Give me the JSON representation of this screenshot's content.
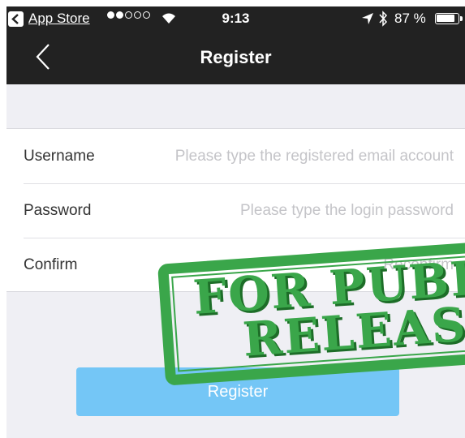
{
  "status_bar": {
    "back_app_label": "App Store",
    "signal_dots_filled": 2,
    "signal_dots_total": 5,
    "time": "9:13",
    "battery_percent_label": "87 %",
    "battery_level": 0.87
  },
  "nav": {
    "title": "Register",
    "back_icon": "chevron-left-icon"
  },
  "form": {
    "username": {
      "label": "Username",
      "placeholder": "Please type the registered email account",
      "value": ""
    },
    "password": {
      "label": "Password",
      "placeholder": "Please type the login password",
      "value": ""
    },
    "confirm": {
      "label": "Confirm",
      "placeholder": "Reconfirm",
      "value": ""
    }
  },
  "register_button": {
    "label": "Register"
  },
  "stamp": {
    "line1": "FOR PUBLIC",
    "line2": "RELEASE"
  },
  "colors": {
    "nav_background": "#222222",
    "screen_background": "#efeff4",
    "button_background": "#74c6f6",
    "stamp_green": "#3aa64a"
  }
}
